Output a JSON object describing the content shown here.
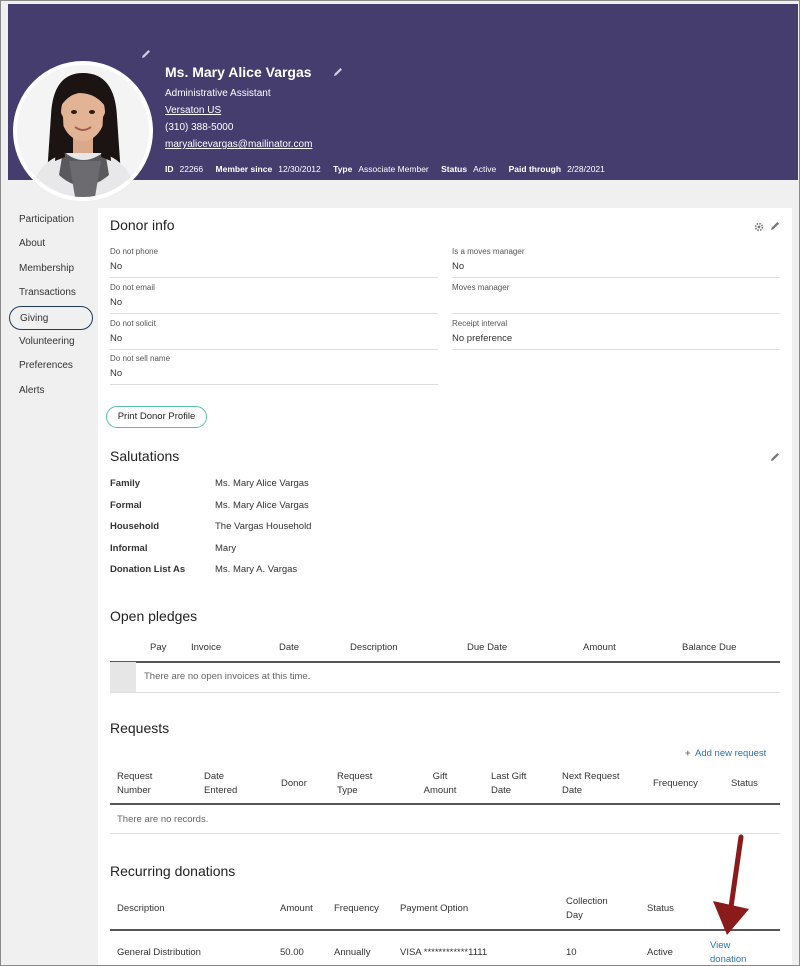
{
  "colors": {
    "header_bg": "#443d6e",
    "accent_green": "#5bbfa4",
    "link_blue": "#2a75a8",
    "arrow_red": "#8b1a1a"
  },
  "profile": {
    "name": "Ms. Mary Alice Vargas",
    "title": "Administrative Assistant",
    "organization": "Versaton US",
    "phone": "(310) 388-5000",
    "email": "maryalicevargas@mailinator.com",
    "meta": {
      "id_label": "ID",
      "id_value": "22266",
      "member_since_label": "Member since",
      "member_since_value": "12/30/2012",
      "type_label": "Type",
      "type_value": "Associate Member",
      "status_label": "Status",
      "status_value": "Active",
      "paid_through_label": "Paid through",
      "paid_through_value": "2/28/2021"
    }
  },
  "sidebar": {
    "items": [
      {
        "label": "Participation"
      },
      {
        "label": "About"
      },
      {
        "label": "Membership"
      },
      {
        "label": "Transactions"
      },
      {
        "label": "Giving",
        "active": true
      },
      {
        "label": "Volunteering"
      },
      {
        "label": "Preferences"
      },
      {
        "label": "Alerts"
      }
    ]
  },
  "donor_info": {
    "title": "Donor info",
    "left": [
      {
        "label": "Do not phone",
        "value": "No"
      },
      {
        "label": "Do not email",
        "value": "No"
      },
      {
        "label": "Do not solicit",
        "value": "No"
      },
      {
        "label": "Do not sell name",
        "value": "No"
      }
    ],
    "right": [
      {
        "label": "Is a moves manager",
        "value": "No"
      },
      {
        "label": "Moves manager",
        "value": ""
      },
      {
        "label": "Receipt interval",
        "value": "No preference"
      }
    ],
    "print_button": "Print Donor Profile"
  },
  "salutations": {
    "title": "Salutations",
    "rows": [
      {
        "label": "Family",
        "value": "Ms. Mary Alice Vargas"
      },
      {
        "label": "Formal",
        "value": "Ms. Mary Alice Vargas"
      },
      {
        "label": "Household",
        "value": "The Vargas Household"
      },
      {
        "label": "Informal",
        "value": "Mary"
      },
      {
        "label": "Donation List As",
        "value": "Ms. Mary A. Vargas"
      }
    ]
  },
  "open_pledges": {
    "title": "Open pledges",
    "columns": [
      "Pay",
      "Invoice",
      "Date",
      "Description",
      "Due Date",
      "Amount",
      "Balance Due"
    ],
    "empty_text": "There are no open invoices at this time."
  },
  "requests": {
    "title": "Requests",
    "add_link": "Add new request",
    "columns": [
      {
        "line1": "Request",
        "line2": "Number"
      },
      {
        "line1": "Date",
        "line2": "Entered"
      },
      {
        "line1": "Donor",
        "line2": ""
      },
      {
        "line1": "Request",
        "line2": "Type"
      },
      {
        "line1": "Gift",
        "line2": "Amount"
      },
      {
        "line1": "Last Gift",
        "line2": "Date"
      },
      {
        "line1": "Next Request",
        "line2": "Date"
      },
      {
        "line1": "Frequency",
        "line2": ""
      },
      {
        "line1": "Status",
        "line2": ""
      }
    ],
    "empty_text": "There are no records."
  },
  "recurring": {
    "title": "Recurring donations",
    "columns": [
      {
        "line1": "Description",
        "line2": ""
      },
      {
        "line1": "Amount",
        "line2": ""
      },
      {
        "line1": "Frequency",
        "line2": ""
      },
      {
        "line1": "Payment Option",
        "line2": ""
      },
      {
        "line1": "Collection",
        "line2": "Day"
      },
      {
        "line1": "Status",
        "line2": ""
      }
    ],
    "rows": [
      {
        "description": "General Distribution",
        "amount": "50.00",
        "frequency": "Annually",
        "payment_option": "VISA ************1111",
        "collection_day": "10",
        "status": "Active",
        "action_line1": "View",
        "action_line2": "donation"
      }
    ]
  }
}
